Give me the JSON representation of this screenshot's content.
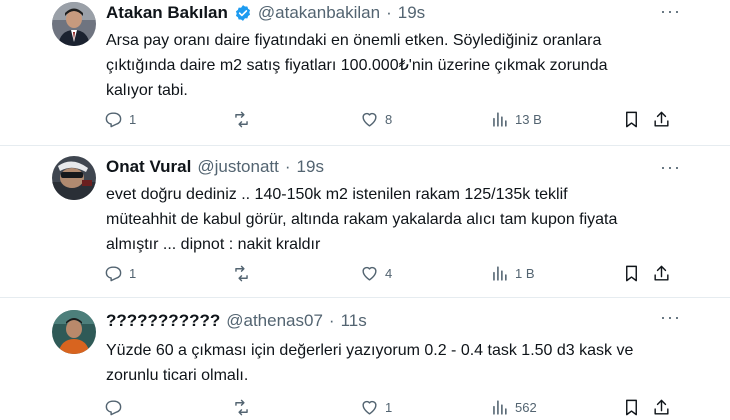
{
  "tweets": [
    {
      "name": "Atakan Bakılan",
      "verified": true,
      "handle": "@atakanbakilan",
      "separator": "·",
      "time": "19s",
      "text_lines": [
        "Arsa pay oranı daire fiyatındaki en önemli etken. Söylediğiniz oranlara",
        "çıktığında daire m2 satış fiyatları 100.000₺'nin üzerine çıkmak zorunda",
        "kalıyor tabi."
      ],
      "replies": "1",
      "retweets": "",
      "likes": "8",
      "views": "13 B"
    },
    {
      "name": "Onat Vural",
      "verified": false,
      "handle": "@justonatt",
      "separator": "·",
      "time": "19s",
      "text_lines": [
        "evet doğru dediniz .. 140-150k m2 istenilen rakam 125/135k teklif",
        "müteahhit de kabul görür, altında  rakam yakalarda alıcı tam kupon fiyata",
        "almıştır ... dipnot : nakit kraldır"
      ],
      "replies": "1",
      "retweets": "",
      "likes": "4",
      "views": "1 B"
    },
    {
      "name": "???????????",
      "verified": false,
      "handle": "@athenas07",
      "separator": "·",
      "time": "11s",
      "text_lines": [
        "Yüzde 60 a çıkması için değerleri yazıyorum 0.2 - 0.4 task 1.50 d3  kask ve",
        "zorunlu ticari olmalı."
      ],
      "replies": "",
      "retweets": "",
      "likes": "1",
      "views": "562"
    }
  ],
  "icons": {
    "more": "more-horizontal-icon",
    "reply": "reply-icon",
    "retweet": "retweet-icon",
    "like": "heart-icon",
    "views": "views-chart-icon",
    "bookmark": "bookmark-icon",
    "share": "share-icon"
  },
  "colors": {
    "text": "#0f1419",
    "muted": "#536471",
    "verified": "#1d9bf0",
    "divider": "#e6ecf0"
  }
}
